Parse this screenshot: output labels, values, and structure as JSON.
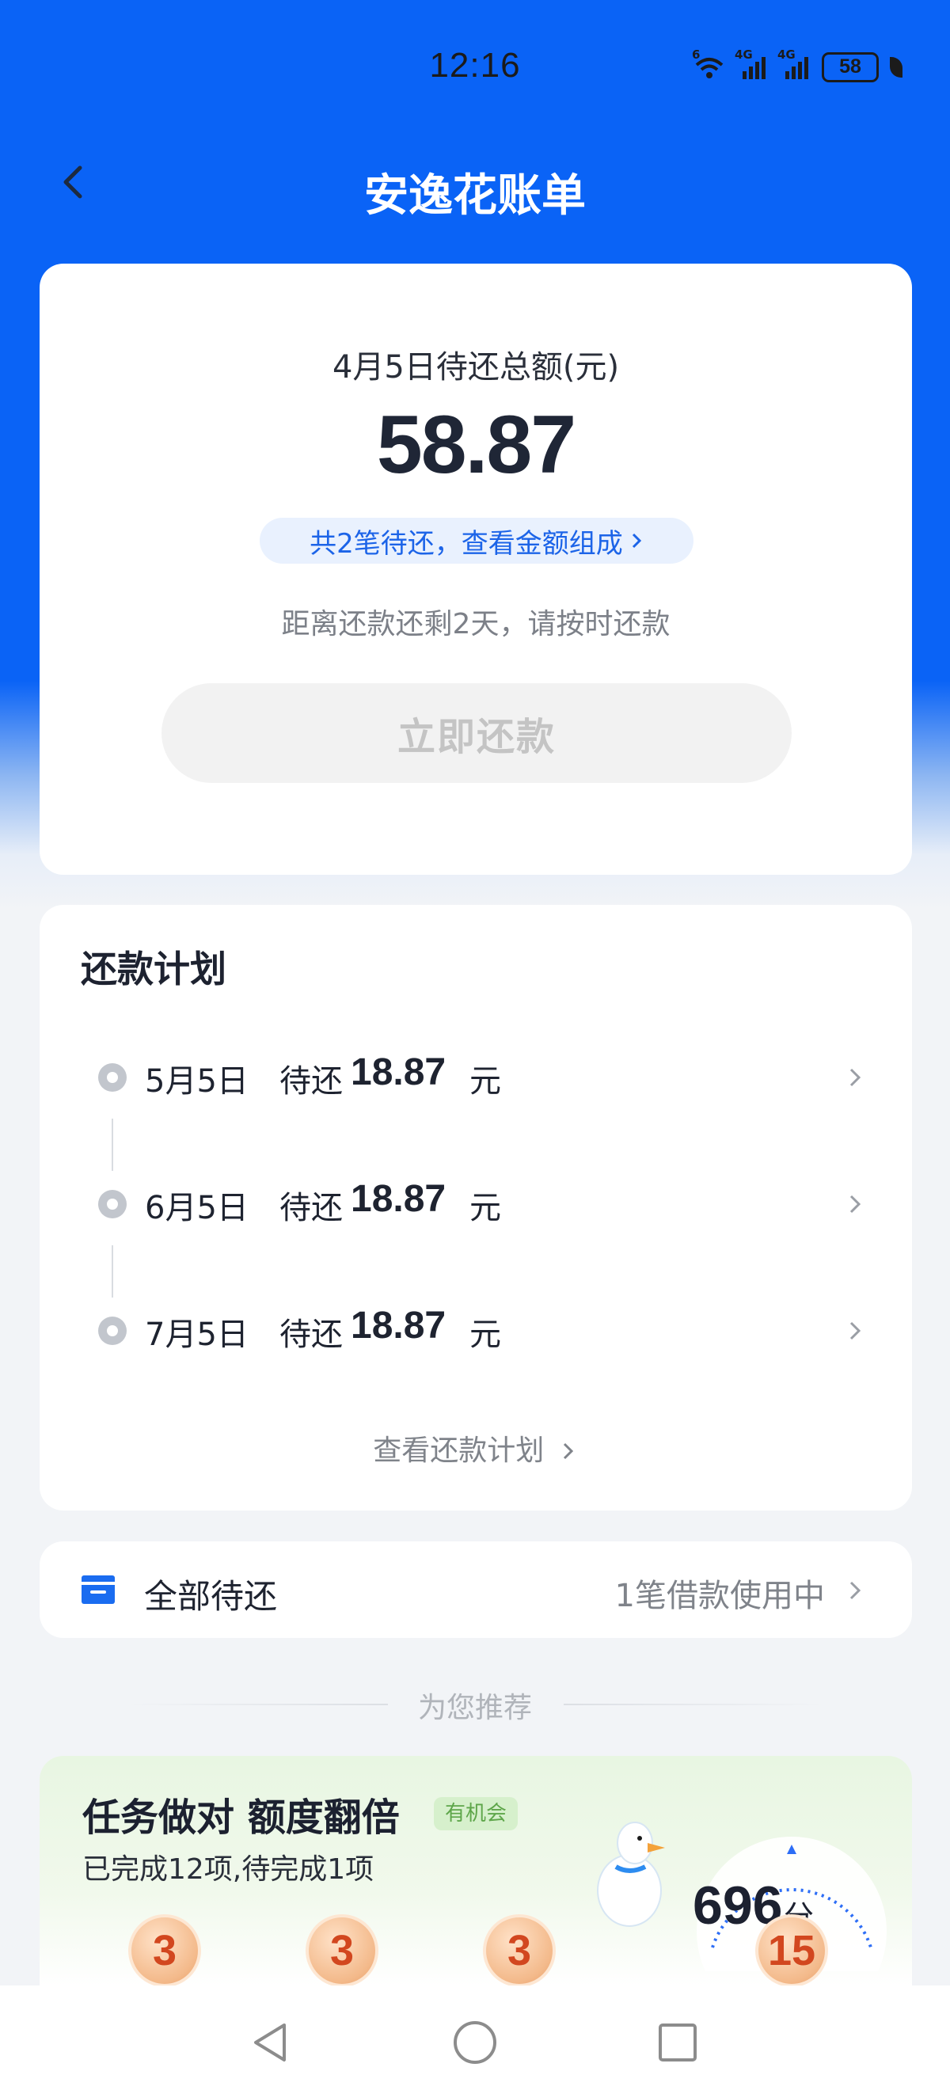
{
  "status_bar": {
    "time": "12:16",
    "wifi_label": "6",
    "signal1_label": "4G",
    "signal2_label": "4G",
    "battery": "58"
  },
  "header": {
    "title": "安逸花账单",
    "back_icon": "back-arrow-icon"
  },
  "bill": {
    "label": "4月5日待还总额(元)",
    "amount": "58.87",
    "pill_text": "共2笔待还，查看金额组成",
    "note": "距离还款还剩2天，请按时还款",
    "pay_button": "立即还款"
  },
  "plan": {
    "title": "还款计划",
    "rows": [
      {
        "date": "5月5日",
        "status": "待还",
        "amount": "18.87",
        "unit": "元"
      },
      {
        "date": "6月5日",
        "status": "待还",
        "amount": "18.87",
        "unit": "元"
      },
      {
        "date": "7月5日",
        "status": "待还",
        "amount": "18.87",
        "unit": "元"
      }
    ],
    "more": "查看还款计划"
  },
  "all_pending": {
    "label": "全部待还",
    "value": "1笔借款使用中"
  },
  "recommend": {
    "divider_text": "为您推荐"
  },
  "promo": {
    "title": "任务做对 额度翻倍",
    "badge": "有机会",
    "subtitle": "已完成12项,待完成1项",
    "score": "696",
    "score_unit": "分",
    "coins": [
      "3",
      "3",
      "3",
      "15"
    ]
  },
  "colors": {
    "brand_blue": "#0a63f6",
    "link_blue": "#1c64e8",
    "text_dark": "#1f2636",
    "text_gray": "#7f838a"
  }
}
